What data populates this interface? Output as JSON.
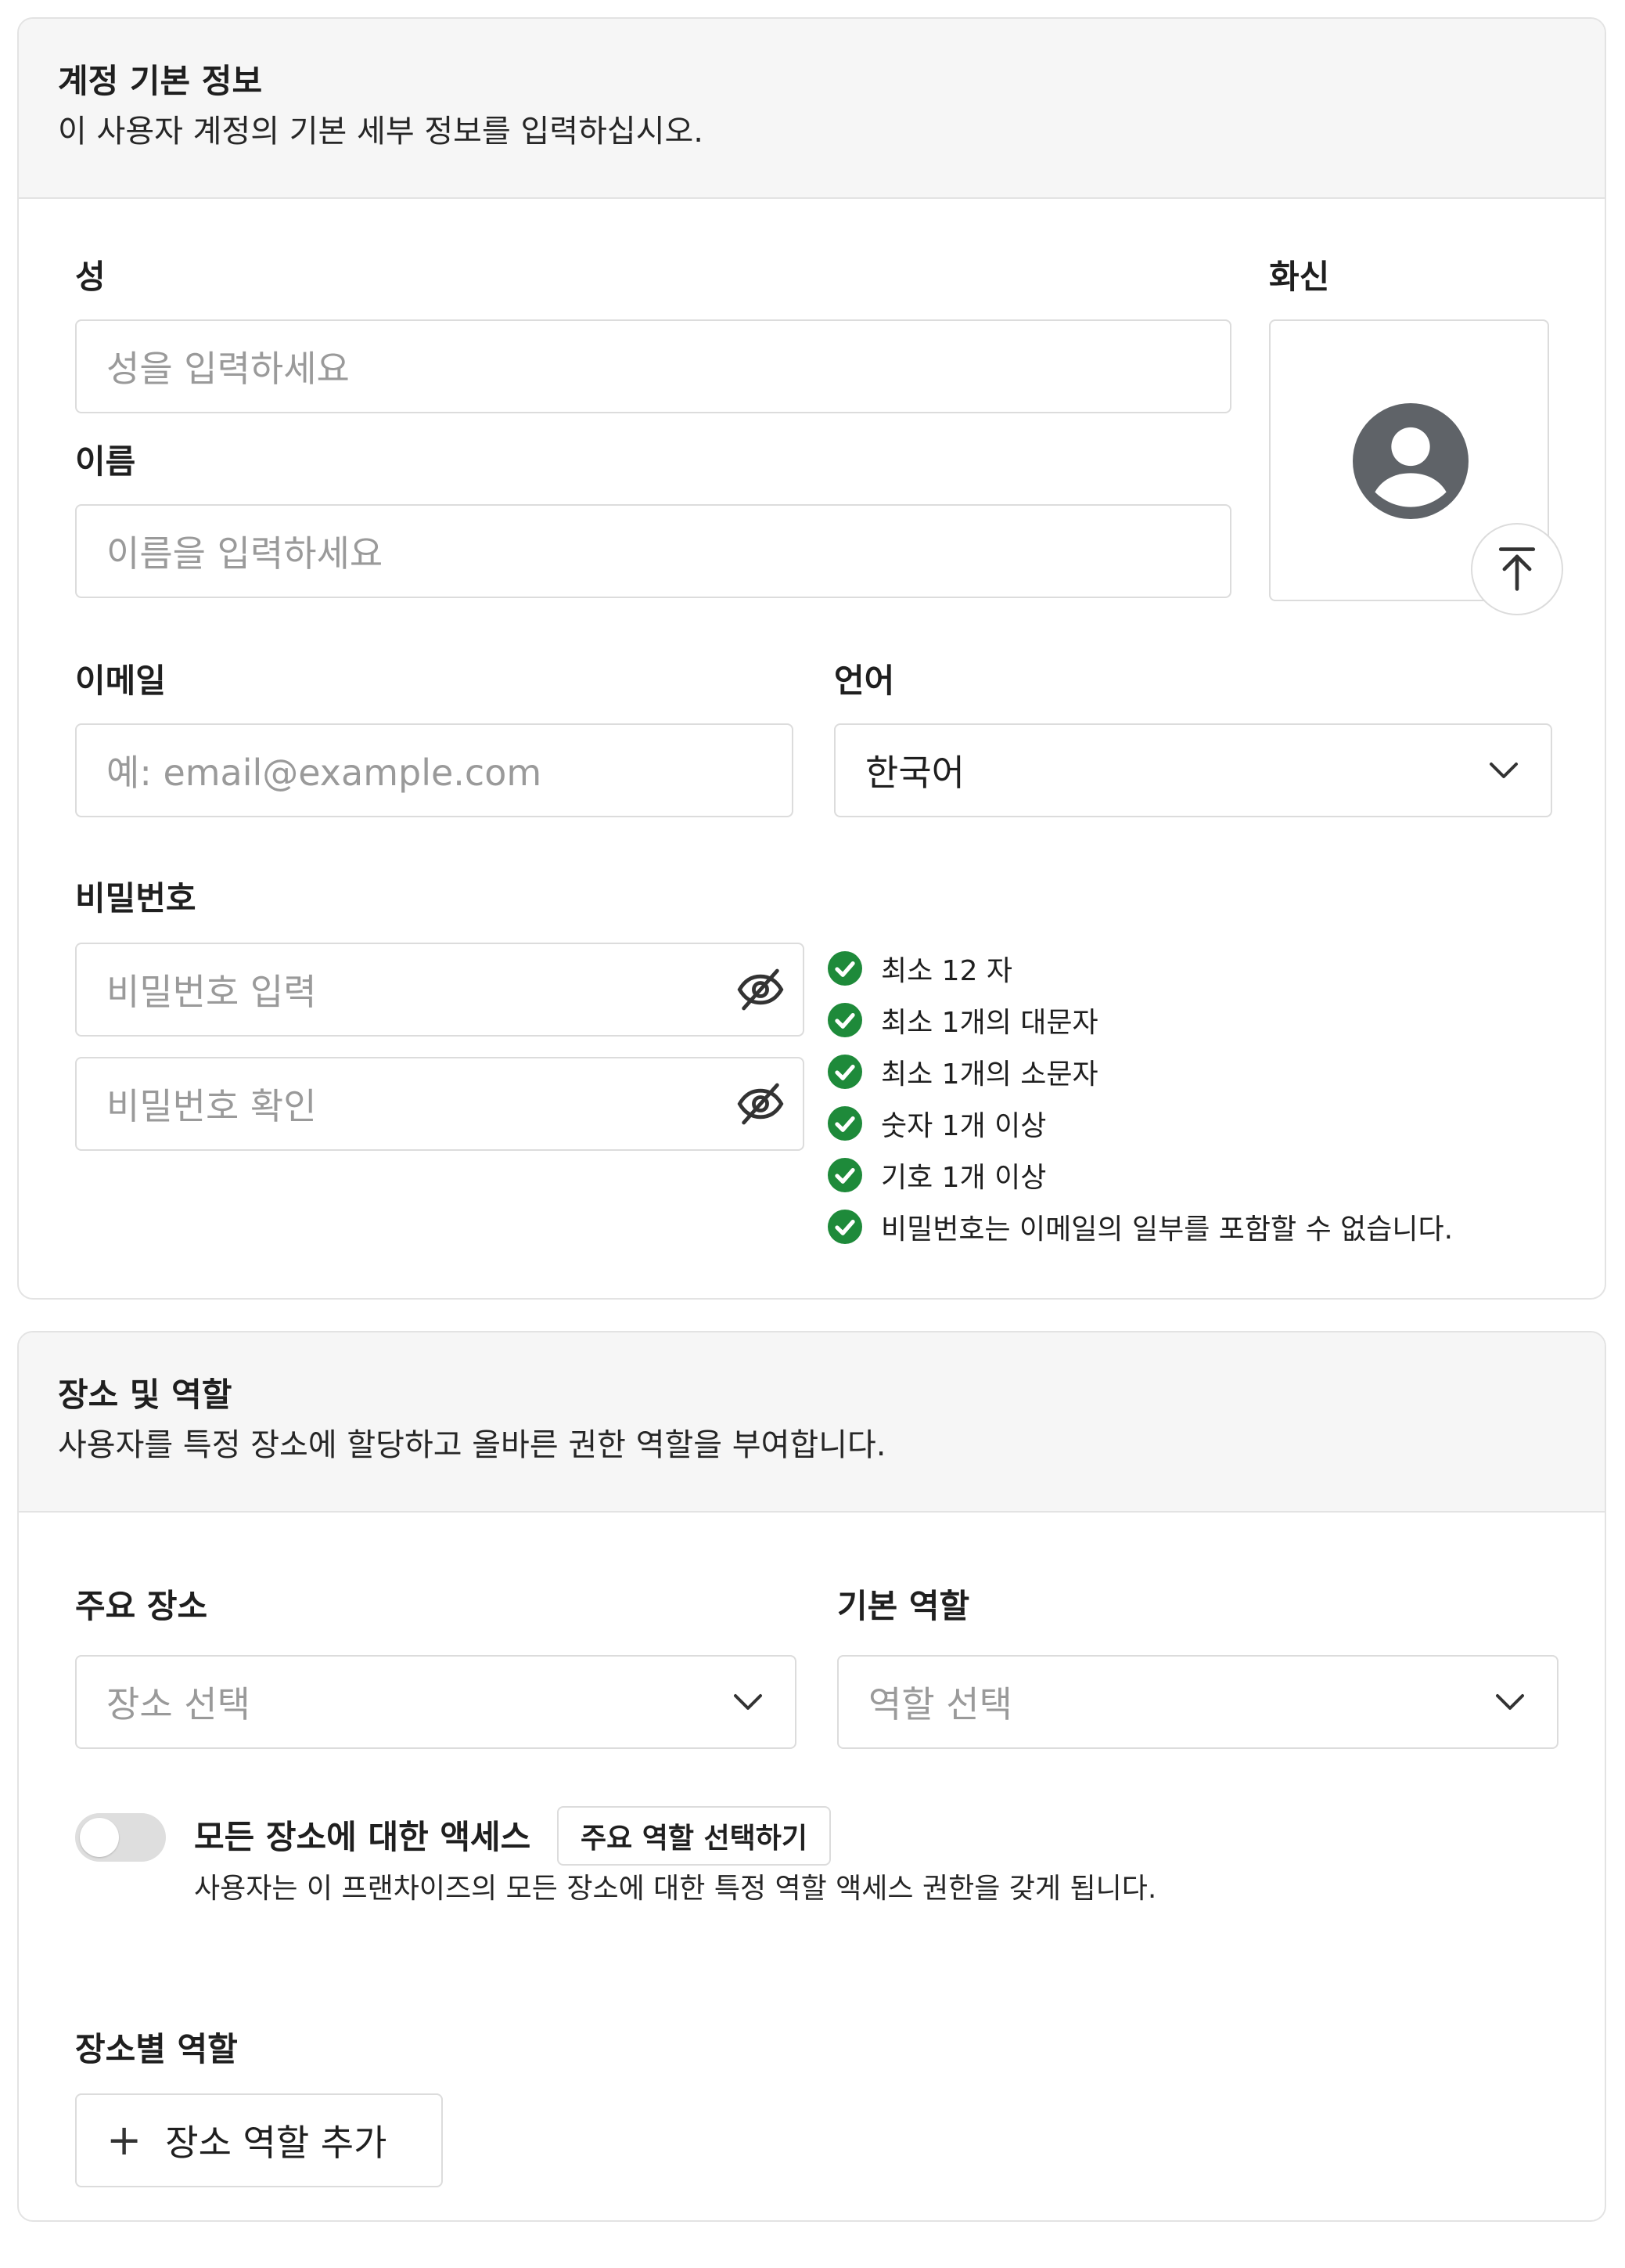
{
  "basic_info": {
    "title": "계정 기본 정보",
    "subtitle": "이 사용자 계정의 기본 세부 정보를 입력하십시오.",
    "last_name": {
      "label": "성",
      "placeholder": "성을 입력하세요"
    },
    "first_name": {
      "label": "이름",
      "placeholder": "이름을 입력하세요"
    },
    "avatar": {
      "label": "화신"
    },
    "email": {
      "label": "이메일",
      "placeholder": "예: email@example.com"
    },
    "language": {
      "label": "언어",
      "value": "한국어"
    },
    "password": {
      "label": "비밀번호",
      "placeholder": "비밀번호 입력",
      "confirm_placeholder": "비밀번호 확인",
      "requirements": [
        "최소 12 자",
        "최소 1개의 대문자",
        "최소 1개의 소문자",
        "숫자 1개 이상",
        "기호 1개 이상",
        "비밀번호는 이메일의 일부를 포함할 수 없습니다."
      ]
    }
  },
  "locations_roles": {
    "title": "장소 및 역할",
    "subtitle": "사용자를 특정 장소에 할당하고 올바른 권한 역할을 부여합니다.",
    "primary_location": {
      "label": "주요 장소",
      "placeholder": "장소 선택"
    },
    "default_role": {
      "label": "기본 역할",
      "placeholder": "역할 선택"
    },
    "all_access": {
      "label": "모든 장소에 대한 액세스",
      "chip": "주요 역할 선택하기",
      "help": "사용자는 이 프랜차이즈의 모든 장소에 대한 특정 역할 액세스 권한을 갖게 됩니다.",
      "enabled": false
    },
    "location_roles": {
      "label": "장소별 역할",
      "add_button": "장소 역할 추가"
    }
  },
  "colors": {
    "check_green": "#1e8a3a",
    "avatar_gray": "#5f6368",
    "border": "#dcdcdc",
    "header_bg": "#f6f6f6"
  }
}
